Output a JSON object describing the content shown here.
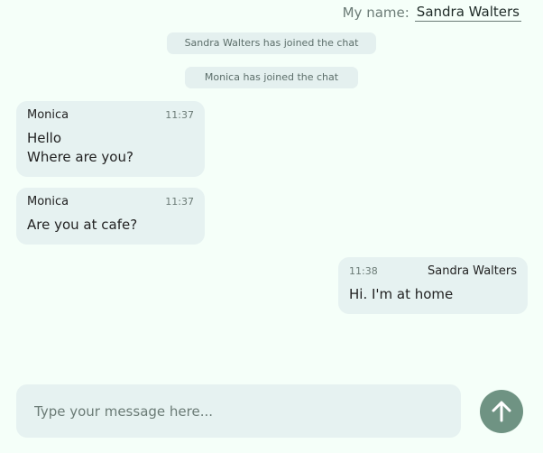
{
  "header": {
    "name_label": "My name:",
    "name_value": "Sandra Walters"
  },
  "system_messages": [
    "Sandra Walters has joined the chat",
    "Monica has joined the chat"
  ],
  "messages": [
    {
      "author": "Monica",
      "time": "11:37",
      "lines": [
        "Hello",
        "Where are you?"
      ]
    },
    {
      "author": "Monica",
      "time": "11:37",
      "lines": [
        "Are you at cafe?"
      ]
    },
    {
      "author": "Sandra Walters",
      "time": "11:38",
      "lines": [
        "Hi. I'm at home"
      ]
    }
  ],
  "composer": {
    "placeholder": "Type your message here...",
    "value": "",
    "send_icon": "arrow-up-icon",
    "send_color": "#6f9383"
  },
  "colors": {
    "background": "#f5fff9",
    "bubble": "#e6f2f1"
  }
}
